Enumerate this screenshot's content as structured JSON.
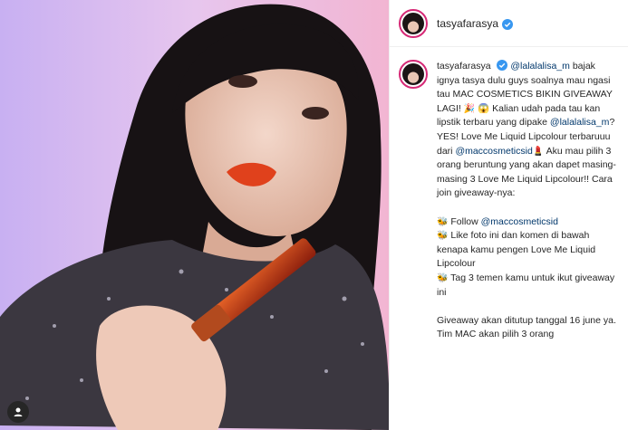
{
  "header": {
    "username": "tasyafarasya",
    "verified_icon": "verified-badge-icon"
  },
  "caption": {
    "author": "tasyafarasya",
    "line1_pre": " ",
    "mention1": "@lalalalisa_m",
    "line1_post": " bajak ignya tasya dulu guys soalnya mau ngasi tau MAC COSMETICS BIKIN GIVEAWAY LAGI! ",
    "emoji1": "🎉",
    "line2": " 😱 Kalian udah pada tau kan lipstik terbaru yang dipake ",
    "mention2": "@lalalalisa_m",
    "line3": "? YES! Love Me Liquid Lipcolour terbaruuu dari ",
    "mention3": "@maccosmeticsid",
    "emoji2": "💄",
    "line4": " Aku mau pilih 3 orang beruntung yang akan dapet masing-masing 3 Love Me Liquid Lipcolour!! Cara join giveaway-nya:",
    "step_emoji": "🐝",
    "step1_pre": " Follow ",
    "step1_mention": "@maccosmeticsid",
    "step2": " Like foto ini dan komen di bawah kenapa kamu pengen Love Me Liquid Lipcolour",
    "step3": " Tag 3 temen kamu untuk ikut giveaway ini",
    "closing": "Giveaway akan ditutup tanggal 16 june ya. Tim MAC akan pilih 3 orang"
  },
  "media": {
    "user_tag_icon": "user-tag-icon",
    "accent_lip": "#e0411c",
    "background_left": "#c9b2f0",
    "background_right": "#f3b7d4"
  }
}
